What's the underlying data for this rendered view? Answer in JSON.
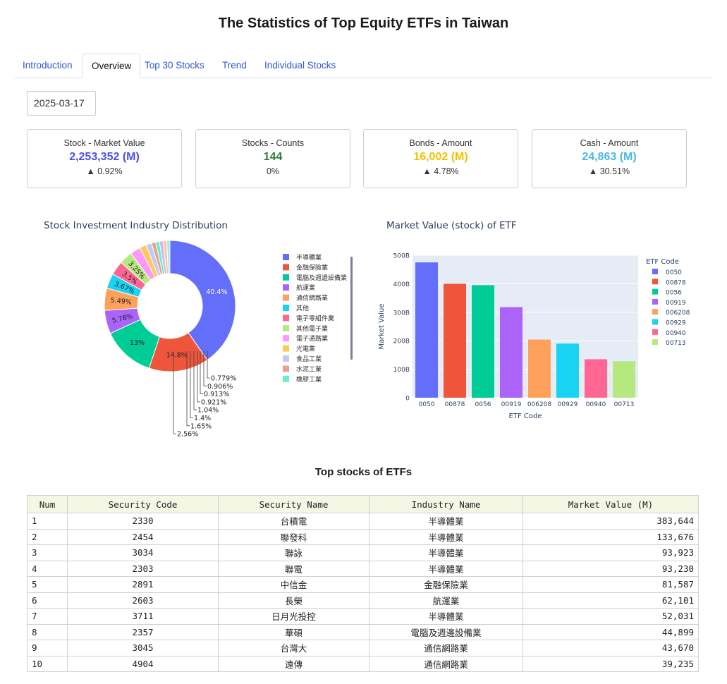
{
  "page_title": "The Statistics of Top Equity ETFs in Taiwan",
  "tabs": [
    "Introduction",
    "Overview",
    "Top 30 Stocks",
    "Trend",
    "Individual Stocks"
  ],
  "active_tab": "Overview",
  "date_value": "2025-03-17",
  "cards": [
    {
      "label": "Stock - Market Value",
      "value": "2,253,352 (M)",
      "change": "▲ 0.92%",
      "color": "#4a4ff0"
    },
    {
      "label": "Stocks - Counts",
      "value": "144",
      "change": "0%",
      "color": "#2e7d32"
    },
    {
      "label": "Bonds - Amount",
      "value": "16,002 (M)",
      "change": "▲ 4.78%",
      "color": "#f2c100"
    },
    {
      "label": "Cash - Amount",
      "value": "24,863 (M)",
      "change": "▲ 30.51%",
      "color": "#49b8e5"
    }
  ],
  "pie_chart_title": "Stock Investment Industry Distribution",
  "bar_chart_title": "Market Value (stock) of ETF",
  "table_title": "Top stocks of ETFs",
  "chart_data": [
    {
      "type": "pie",
      "title": "Stock Investment Industry Distribution",
      "hole": true,
      "slices": [
        {
          "label": "半導體業",
          "percent": 40.4,
          "color": "#636efa"
        },
        {
          "label": "金融保險業",
          "percent": 14.8,
          "color": "#ef553b"
        },
        {
          "label": "電腦及週邊設備業",
          "percent": 13,
          "color": "#00cc96"
        },
        {
          "label": "航運業",
          "percent": 5.78,
          "color": "#ab63fa"
        },
        {
          "label": "通信網路業",
          "percent": 5.49,
          "color": "#ffa15a"
        },
        {
          "label": "其他",
          "percent": 3.67,
          "color": "#19d3f3"
        },
        {
          "label": "電子零組件業",
          "percent": 3.5,
          "color": "#ff6692"
        },
        {
          "label": "其他電子業",
          "percent": 3.25,
          "color": "#b6e880"
        },
        {
          "label": "電子通路業",
          "percent": 2.56,
          "color": "#ff97ff"
        },
        {
          "label": "光電業",
          "percent": 1.65,
          "color": "#fecb52"
        },
        {
          "label": "食品工業",
          "percent": 1.4,
          "color": "#c5c8f7"
        },
        {
          "label": "水泥工業",
          "percent": 1.04,
          "color": "#e8a18f"
        },
        {
          "label": "橡膠工業",
          "percent": 0.921,
          "color": "#66f0c4"
        },
        {
          "label": "",
          "percent": 0.913,
          "color": "#d3b2f7"
        },
        {
          "label": "",
          "percent": 0.906,
          "color": "#f8c9a2"
        },
        {
          "label": "",
          "percent": 0.779,
          "color": "#a2e6f5"
        }
      ],
      "outside_label_order": [
        "0.779%",
        "0.906%",
        "0.913%",
        "0.921%",
        "1.04%",
        "1.4%",
        "1.65%",
        "2.56%"
      ]
    },
    {
      "type": "bar",
      "title": "Market Value (stock) of ETF",
      "xlabel": "ETF Code",
      "ylabel": "Market Value",
      "legend_title": "ETF Code",
      "categories": [
        "0050",
        "00878",
        "0056",
        "00919",
        "006208",
        "00929",
        "00940",
        "00713"
      ],
      "values": [
        475,
        400,
        395,
        318,
        204,
        190,
        135,
        128
      ],
      "unit": "B",
      "yticks": [
        "0",
        "100B",
        "200B",
        "300B",
        "400B",
        "500B"
      ],
      "ylim": [
        0,
        500
      ],
      "colors": [
        "#636efa",
        "#ef553b",
        "#00cc96",
        "#ab63fa",
        "#ffa15a",
        "#19d3f3",
        "#ff6692",
        "#b6e880"
      ]
    }
  ],
  "table": {
    "headers": [
      "Num",
      "Security Code",
      "Security Name",
      "Industry Name",
      "Market Value (M)"
    ],
    "rows": [
      [
        "1",
        "2330",
        "台積電",
        "半導體業",
        "383,644"
      ],
      [
        "2",
        "2454",
        "聯發科",
        "半導體業",
        "133,676"
      ],
      [
        "3",
        "3034",
        "聯詠",
        "半導體業",
        "93,923"
      ],
      [
        "4",
        "2303",
        "聯電",
        "半導體業",
        "93,230"
      ],
      [
        "5",
        "2891",
        "中信金",
        "金融保險業",
        "81,587"
      ],
      [
        "6",
        "2603",
        "長榮",
        "航運業",
        "62,101"
      ],
      [
        "7",
        "3711",
        "日月光投控",
        "半導體業",
        "52,031"
      ],
      [
        "8",
        "2357",
        "華碩",
        "電腦及週邊設備業",
        "44,899"
      ],
      [
        "9",
        "3045",
        "台灣大",
        "通信網路業",
        "43,670"
      ],
      [
        "10",
        "4904",
        "遠傳",
        "通信網路業",
        "39,235"
      ]
    ]
  }
}
